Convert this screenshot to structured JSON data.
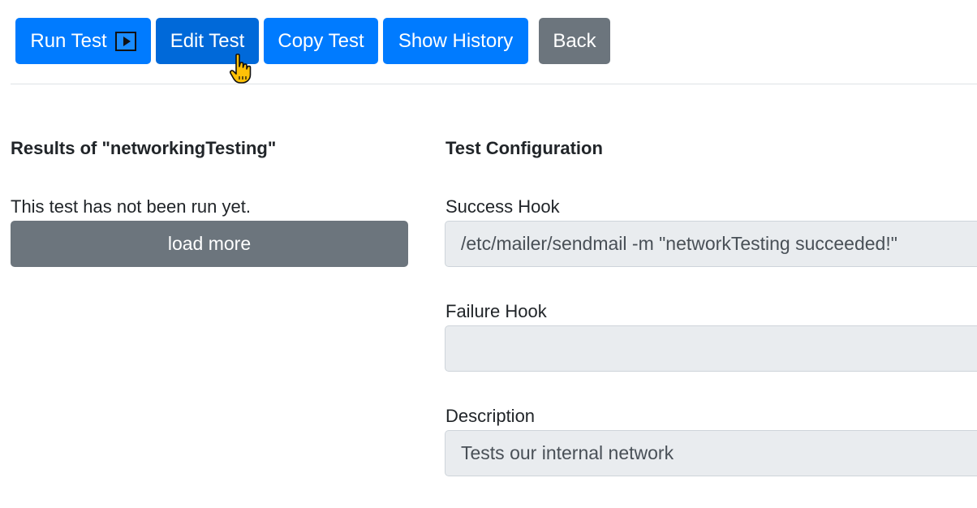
{
  "toolbar": {
    "run_label": "Run Test",
    "edit_label": "Edit Test",
    "copy_label": "Copy Test",
    "history_label": "Show History",
    "back_label": "Back"
  },
  "results": {
    "heading": "Results of \"networkingTesting\"",
    "status_text": "This test has not been run yet.",
    "load_more_label": "load more"
  },
  "config": {
    "heading": "Test Configuration",
    "success_hook": {
      "label": "Success Hook",
      "value": "/etc/mailer/sendmail -m \"networkTesting succeeded!\""
    },
    "failure_hook": {
      "label": "Failure Hook",
      "value": ""
    },
    "description": {
      "label": "Description",
      "value": "Tests our internal network"
    }
  },
  "colors": {
    "primary": "#007bff",
    "primary_hover": "#0069d9",
    "secondary": "#6c757d",
    "field_bg": "#e9ecef"
  },
  "icons": {
    "run": "play-icon",
    "cursor": "hand-pointer-icon"
  }
}
